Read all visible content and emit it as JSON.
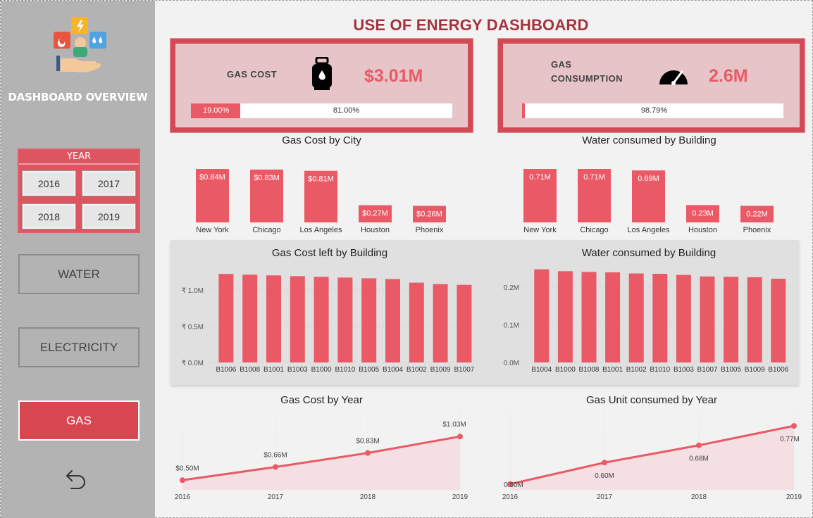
{
  "sidebar": {
    "title": "DASHBOARD OVERVIEW",
    "year_panel": {
      "header": "YEAR",
      "years": [
        "2016",
        "2017",
        "2018",
        "2019"
      ]
    },
    "nav": {
      "water": "WATER",
      "electricity": "ELECTRICITY",
      "gas": "GAS"
    },
    "active_nav": "GAS",
    "icons": {
      "logo": "energy-hand-icon",
      "back": "undo-arrow-icon"
    }
  },
  "header": {
    "title": "USE OF ENERGY DASHBOARD"
  },
  "colors": {
    "accent": "#ea5a66",
    "title": "#a3333d",
    "kpi_bg": "#e7c4c7",
    "kpi_border": "#d24a56",
    "sidebar": "#b3b3b3"
  },
  "kpis": {
    "gas_cost": {
      "label": "GAS COST",
      "value": "$3.01M",
      "icon": "gas-cylinder-icon",
      "progress_label": "19.00%",
      "remaining_label": "81.00%",
      "progress": 0.19
    },
    "gas_consumption": {
      "label_line1": "GAS",
      "label_line2": "CONSUMPTION",
      "value": "2.6M",
      "icon": "speedometer-icon",
      "progress_label": "98.79%",
      "progress": 0.0121
    }
  },
  "chart_data": [
    {
      "id": "gas-cost-by-city",
      "type": "bar",
      "title": "Gas Cost by City",
      "categories": [
        "New York",
        "Chicago",
        "Los Angeles",
        "Houston",
        "Phoenix"
      ],
      "values": [
        0.84,
        0.83,
        0.81,
        0.27,
        0.26
      ],
      "data_labels": [
        "$0.84M",
        "$0.83M",
        "$0.81M",
        "$0.27M",
        "$0.26M"
      ],
      "ylim": [
        0,
        0.84
      ]
    },
    {
      "id": "water-by-building-top",
      "type": "bar",
      "title": "Water consumed by Building",
      "categories": [
        "New York",
        "Chicago",
        "Los Angeles",
        "Houston",
        "Phoenix"
      ],
      "values": [
        0.71,
        0.71,
        0.69,
        0.23,
        0.22
      ],
      "data_labels": [
        "0.71M",
        "0.71M",
        "0.69M",
        "0.23M",
        "0.22M"
      ],
      "ylim": [
        0,
        0.71
      ]
    },
    {
      "id": "gas-cost-left-by-building",
      "type": "bar",
      "title": "Gas Cost left by Building",
      "categories": [
        "B1006",
        "B1008",
        "B1001",
        "B1003",
        "B1000",
        "B1010",
        "B1005",
        "B1004",
        "B1002",
        "B1009",
        "B1007"
      ],
      "values": [
        1.22,
        1.21,
        1.2,
        1.19,
        1.18,
        1.17,
        1.16,
        1.15,
        1.1,
        1.08,
        1.07
      ],
      "yticks": [
        0,
        0.5,
        1.0
      ],
      "ytick_labels": [
        "₹ 0.0M",
        "₹ 0.5M",
        "₹ 1.0M"
      ],
      "ylim": [
        0,
        1.3
      ]
    },
    {
      "id": "water-by-building-bottom",
      "type": "bar",
      "title": "Water consumed by Building",
      "categories": [
        "B1004",
        "B1000",
        "B1008",
        "B1001",
        "B1002",
        "B1010",
        "B1003",
        "B1007",
        "B1005",
        "B1009",
        "B1006"
      ],
      "values": [
        0.247,
        0.242,
        0.24,
        0.239,
        0.236,
        0.235,
        0.232,
        0.228,
        0.227,
        0.226,
        0.222
      ],
      "yticks": [
        0,
        0.1,
        0.2
      ],
      "ytick_labels": [
        "0.0M",
        "0.1M",
        "0.2M"
      ],
      "ylim": [
        0,
        0.25
      ]
    },
    {
      "id": "gas-cost-by-year",
      "type": "area",
      "title": "Gas Cost by Year",
      "x": [
        "2016",
        "2017",
        "2018",
        "2019"
      ],
      "values": [
        0.5,
        0.66,
        0.83,
        1.03
      ],
      "data_labels": [
        "$0.50M",
        "$0.66M",
        "$0.83M",
        "$1.03M"
      ],
      "ylim": [
        0.4,
        1.1
      ]
    },
    {
      "id": "gas-unit-by-year",
      "type": "area",
      "title": "Gas Unit consumed by Year",
      "x": [
        "2016",
        "2017",
        "2018",
        "2019"
      ],
      "values": [
        0.5,
        0.6,
        0.68,
        0.77
      ],
      "data_labels": [
        "0.50M",
        "0.60M",
        "0.68M",
        "0.77M"
      ],
      "ylim": [
        0.48,
        0.79
      ]
    }
  ]
}
